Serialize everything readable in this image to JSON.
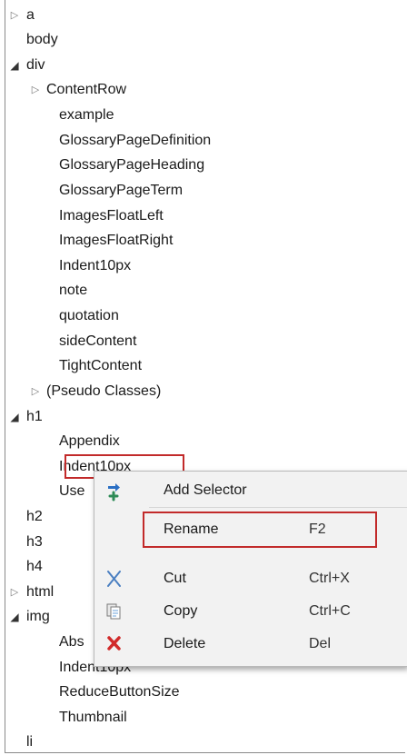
{
  "tree": {
    "rows": [
      {
        "label": "a",
        "expander": "▷",
        "name": "tree-item-a"
      },
      {
        "label": "body",
        "expander": "",
        "name": "tree-item-body"
      },
      {
        "label": "div",
        "expander": "◢",
        "name": "tree-item-div"
      },
      {
        "label": "ContentRow",
        "expander": "▷",
        "name": "tree-item-contentrow"
      },
      {
        "label": "example",
        "expander": "",
        "name": "tree-item-example"
      },
      {
        "label": "GlossaryPageDefinition",
        "expander": "",
        "name": "tree-item-glossarypagedefinition"
      },
      {
        "label": "GlossaryPageHeading",
        "expander": "",
        "name": "tree-item-glossarypageheading"
      },
      {
        "label": "GlossaryPageTerm",
        "expander": "",
        "name": "tree-item-glossarypageterm"
      },
      {
        "label": "ImagesFloatLeft",
        "expander": "",
        "name": "tree-item-imagesfloatleft"
      },
      {
        "label": "ImagesFloatRight",
        "expander": "",
        "name": "tree-item-imagesfloatright"
      },
      {
        "label": "Indent10px",
        "expander": "",
        "name": "tree-item-div-indent10px"
      },
      {
        "label": "note",
        "expander": "",
        "name": "tree-item-note"
      },
      {
        "label": "quotation",
        "expander": "",
        "name": "tree-item-quotation"
      },
      {
        "label": "sideContent",
        "expander": "",
        "name": "tree-item-sidecontent"
      },
      {
        "label": "TightContent",
        "expander": "",
        "name": "tree-item-tightcontent"
      },
      {
        "label": "(Pseudo Classes)",
        "expander": "▷",
        "name": "tree-item-pseudo-classes"
      },
      {
        "label": "h1",
        "expander": "◢",
        "name": "tree-item-h1"
      },
      {
        "label": "Appendix",
        "expander": "",
        "name": "tree-item-appendix"
      },
      {
        "label": "Indent10px",
        "expander": "",
        "name": "tree-item-h1-indent10px"
      },
      {
        "label": "Use",
        "expander": "",
        "name": "tree-item-use"
      },
      {
        "label": "h2",
        "expander": "",
        "name": "tree-item-h2"
      },
      {
        "label": "h3",
        "expander": "",
        "name": "tree-item-h3"
      },
      {
        "label": "h4",
        "expander": "",
        "name": "tree-item-h4"
      },
      {
        "label": "html",
        "expander": "▷",
        "name": "tree-item-html"
      },
      {
        "label": "img",
        "expander": "◢",
        "name": "tree-item-img"
      },
      {
        "label": "Abs",
        "expander": "",
        "name": "tree-item-abs"
      },
      {
        "label": "Indent10px",
        "expander": "",
        "name": "tree-item-img-indent10px"
      },
      {
        "label": "ReduceButtonSize",
        "expander": "",
        "name": "tree-item-reducebuttonsize"
      },
      {
        "label": "Thumbnail",
        "expander": "",
        "name": "tree-item-thumbnail"
      },
      {
        "label": "li",
        "expander": "",
        "name": "tree-item-li"
      }
    ]
  },
  "context_menu": {
    "items": [
      {
        "label": "Add Selector",
        "shortcut": "",
        "icon": "add-selector-icon"
      },
      {
        "label": "Rename",
        "shortcut": "F2",
        "icon": ""
      },
      {
        "label": "Cut",
        "shortcut": "Ctrl+X",
        "icon": "cut-icon"
      },
      {
        "label": "Copy",
        "shortcut": "Ctrl+C",
        "icon": "copy-icon"
      },
      {
        "label": "Delete",
        "shortcut": "Del",
        "icon": "delete-icon"
      }
    ]
  },
  "colors": {
    "highlight_border": "#c22a2a",
    "menu_background": "#f2f2f2",
    "add_icon": "#2e8b57",
    "add_arrow": "#2a6fc4",
    "delete_icon": "#d12a2a",
    "cut_icon": "#4a7fc1"
  }
}
